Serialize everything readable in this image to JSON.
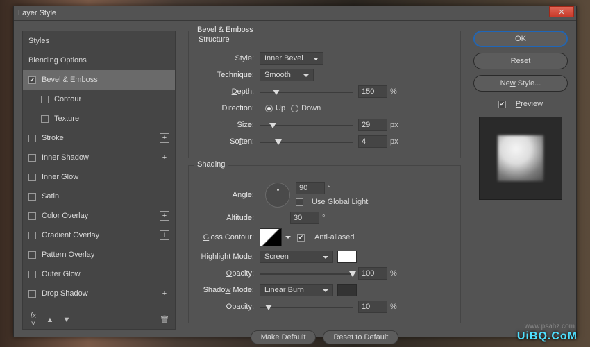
{
  "window": {
    "title": "Layer Style"
  },
  "sidebar": {
    "header": "Styles",
    "blending": "Blending Options",
    "items": [
      {
        "label": "Bevel & Emboss",
        "checked": true,
        "selected": true
      },
      {
        "label": "Contour",
        "checked": false,
        "sub": true
      },
      {
        "label": "Texture",
        "checked": false,
        "sub": true
      },
      {
        "label": "Stroke",
        "checked": false,
        "plus": true
      },
      {
        "label": "Inner Shadow",
        "checked": false,
        "plus": true
      },
      {
        "label": "Inner Glow",
        "checked": false
      },
      {
        "label": "Satin",
        "checked": false
      },
      {
        "label": "Color Overlay",
        "checked": false,
        "plus": true
      },
      {
        "label": "Gradient Overlay",
        "checked": false,
        "plus": true
      },
      {
        "label": "Pattern Overlay",
        "checked": false
      },
      {
        "label": "Outer Glow",
        "checked": false
      },
      {
        "label": "Drop Shadow",
        "checked": false,
        "plus": true
      }
    ]
  },
  "panel": {
    "title": "Bevel & Emboss",
    "structure": {
      "title": "Structure",
      "style_label": "Style:",
      "style_value": "Inner Bevel",
      "technique_label": "Technique:",
      "technique_value": "Smooth",
      "depth_label": "Depth:",
      "depth_value": "150",
      "depth_unit": "%",
      "direction_label": "Direction:",
      "up": "Up",
      "down": "Down",
      "size_label": "Size:",
      "size_value": "29",
      "size_unit": "px",
      "soften_label": "Soften:",
      "soften_value": "4",
      "soften_unit": "px"
    },
    "shading": {
      "title": "Shading",
      "angle_label": "Angle:",
      "angle_value": "90",
      "angle_unit": "°",
      "global_light": "Use Global Light",
      "altitude_label": "Altitude:",
      "altitude_value": "30",
      "altitude_unit": "°",
      "gloss_label": "Gloss Contour:",
      "anti_aliased": "Anti-aliased",
      "highlight_mode_label": "Highlight Mode:",
      "highlight_mode_value": "Screen",
      "highlight_opacity_label": "Opacity:",
      "highlight_opacity_value": "100",
      "opacity_unit": "%",
      "shadow_mode_label": "Shadow Mode:",
      "shadow_mode_value": "Linear Burn",
      "shadow_opacity_label": "Opacity:",
      "shadow_opacity_value": "10",
      "highlight_color": "#ffffff",
      "shadow_color": "#333333"
    },
    "footer": {
      "make_default": "Make Default",
      "reset_default": "Reset to Default"
    }
  },
  "right": {
    "ok": "OK",
    "reset": "Reset",
    "new_style": "New Style...",
    "preview": "Preview"
  },
  "watermark": "UiBQ.CoM"
}
